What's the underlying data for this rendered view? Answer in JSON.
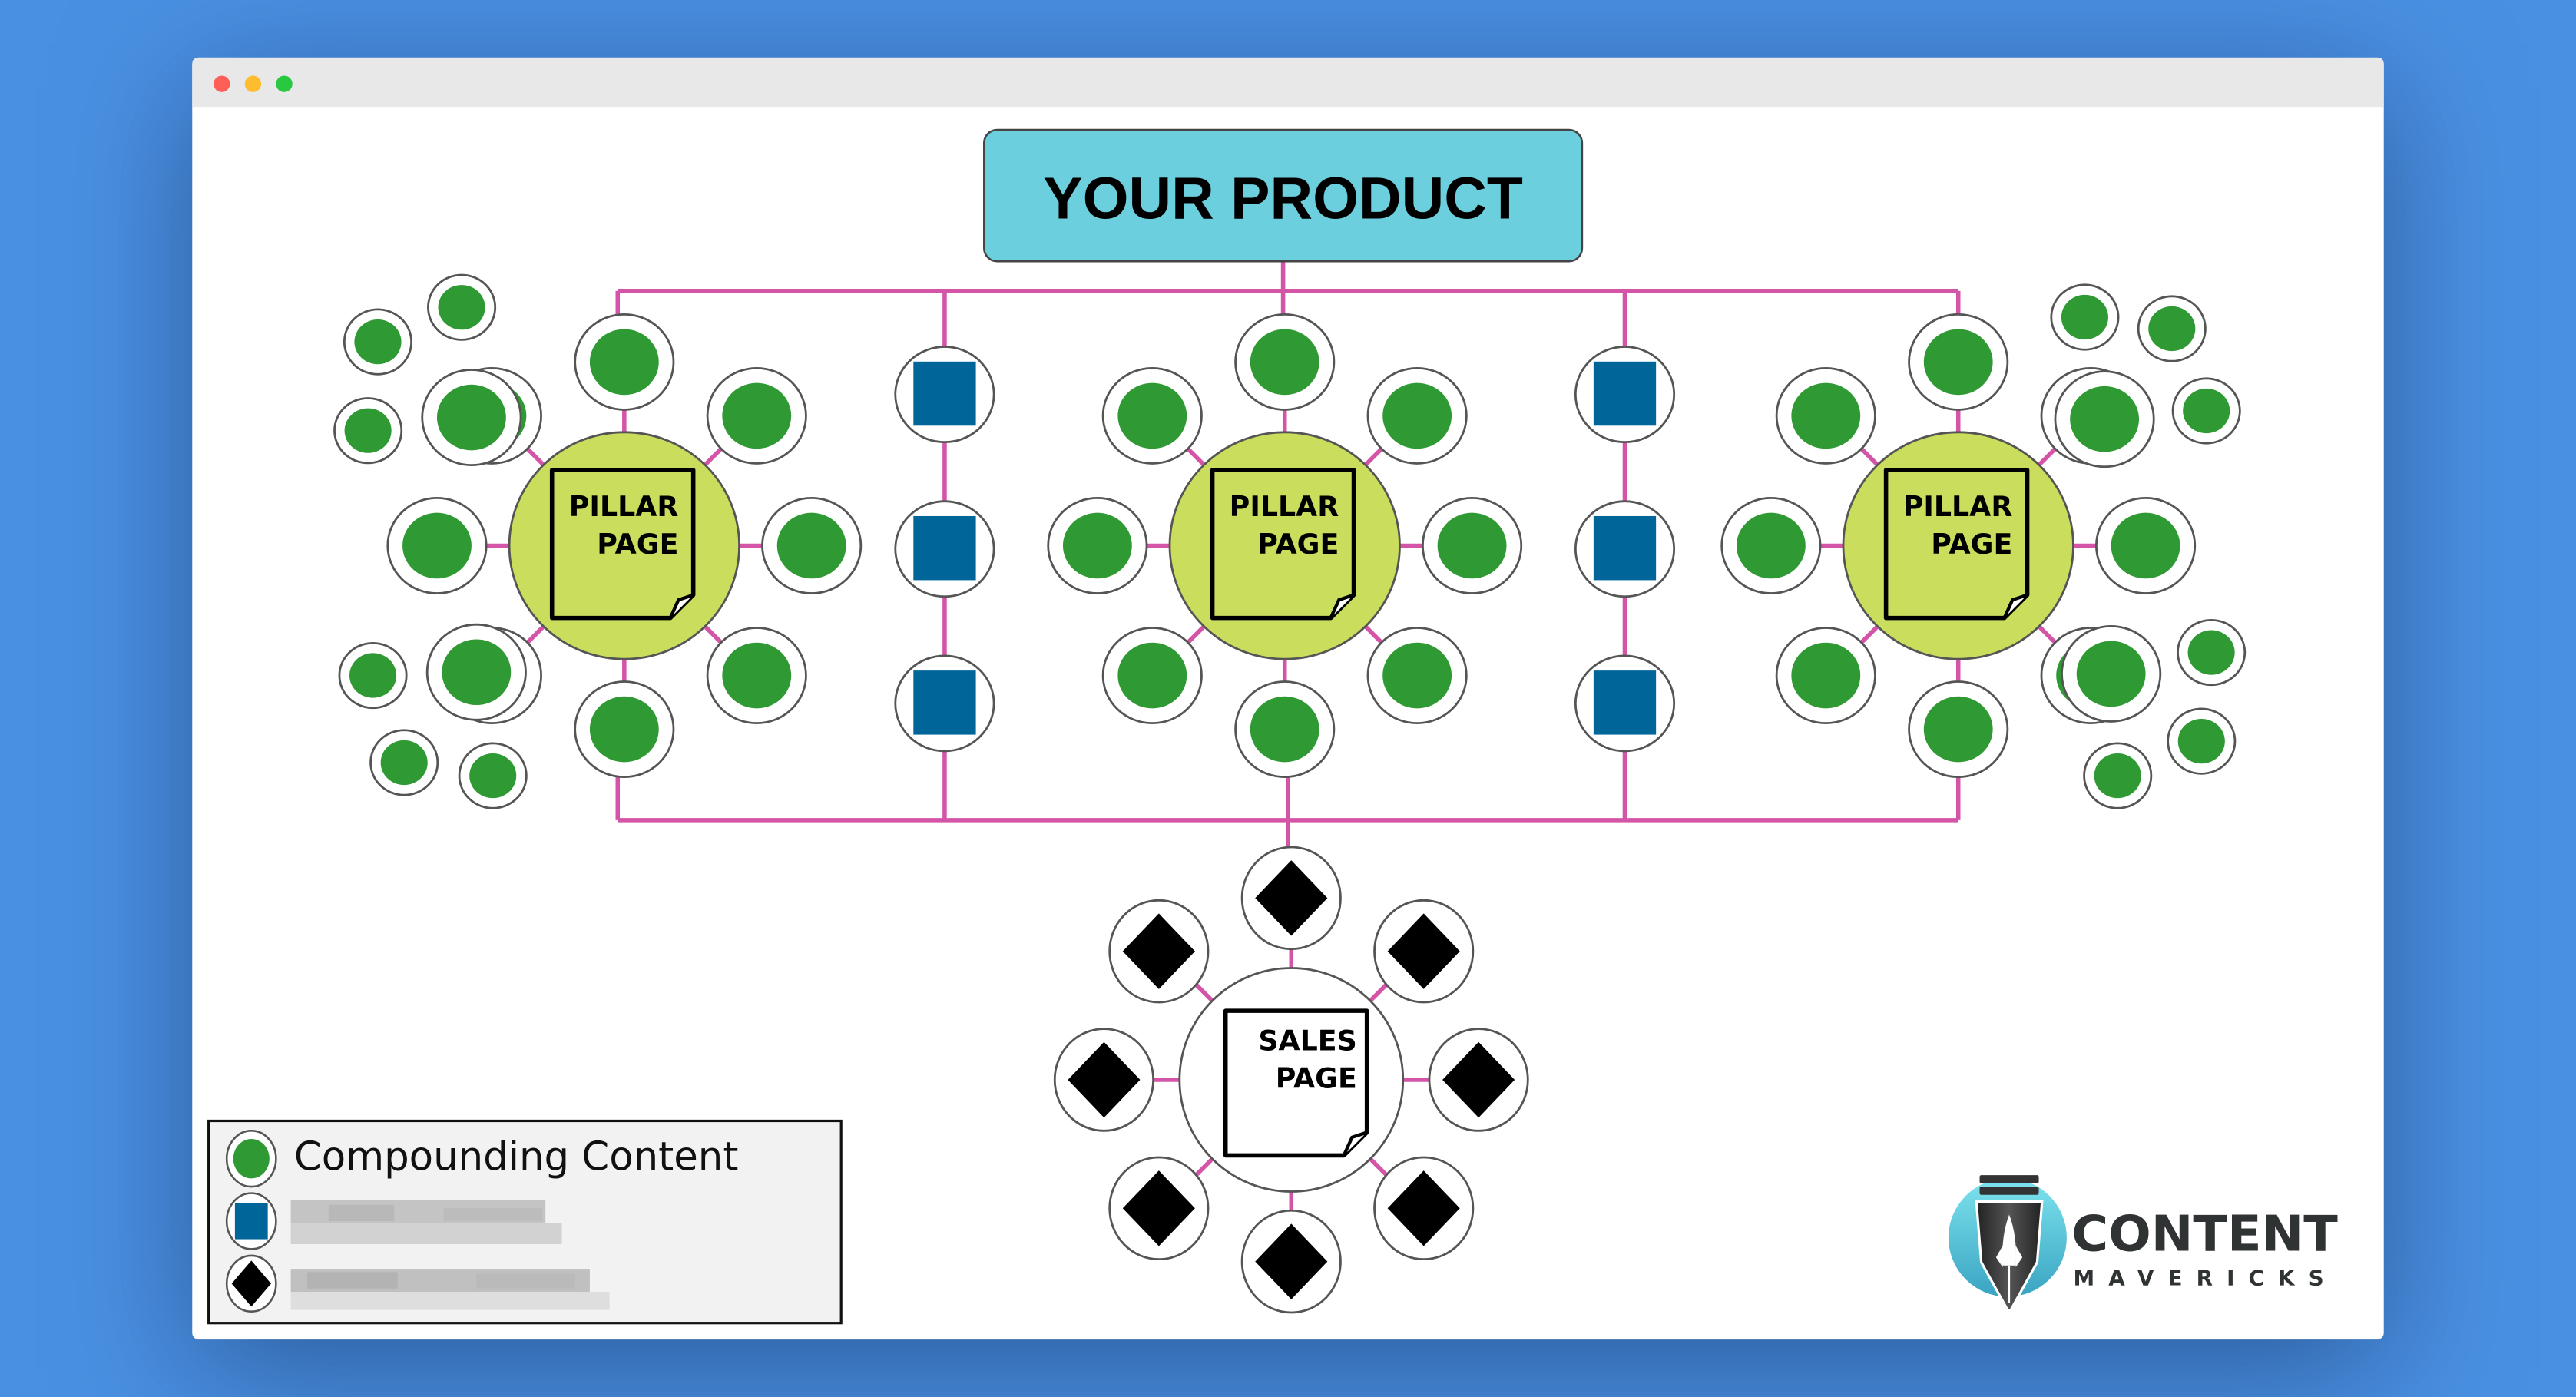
{
  "window": {
    "traffic_lights": [
      {
        "name": "close",
        "color": "#ff5f57"
      },
      {
        "name": "minimize",
        "color": "#febc2e"
      },
      {
        "name": "maximize",
        "color": "#28c840"
      }
    ],
    "titlebar_color": "#e8e8e8",
    "background_color": "#4a90e2"
  },
  "diagram": {
    "product": {
      "label": "YOUR PRODUCT",
      "fill": "#6bcfdd"
    },
    "connector_color": "#d455a8",
    "pillars": [
      {
        "line1": "PILLAR",
        "line2": "PAGE",
        "fill": "#cbdd5c",
        "spokes": 8,
        "extra_nodes": 8,
        "extra_side": "left"
      },
      {
        "line1": "PILLAR",
        "line2": "PAGE",
        "fill": "#cbdd5c",
        "spokes": 8,
        "extra_nodes": 0,
        "extra_side": "none"
      },
      {
        "line1": "PILLAR",
        "line2": "PAGE",
        "fill": "#cbdd5c",
        "spokes": 8,
        "extra_nodes": 8,
        "extra_side": "right"
      }
    ],
    "square_columns": [
      {
        "nodes": 3,
        "fill": "#006699"
      },
      {
        "nodes": 3,
        "fill": "#006699"
      }
    ],
    "sales": {
      "line1": "SALES",
      "line2": "PAGE",
      "fill": "#ffffff",
      "spokes": 8
    },
    "node_colors": {
      "green": "#2f9933",
      "blue": "#006699",
      "black": "#000000"
    }
  },
  "legend": {
    "items": [
      {
        "icon": "green-circle-icon",
        "label": "Compounding Content",
        "redacted": false
      },
      {
        "icon": "blue-square-icon",
        "label": "",
        "redacted": true
      },
      {
        "icon": "black-diamond-icon",
        "label": "",
        "redacted": true
      }
    ]
  },
  "logo": {
    "line1": "CONTENT",
    "line2": "MAVERICKS",
    "accent": "#5ec8dc"
  }
}
